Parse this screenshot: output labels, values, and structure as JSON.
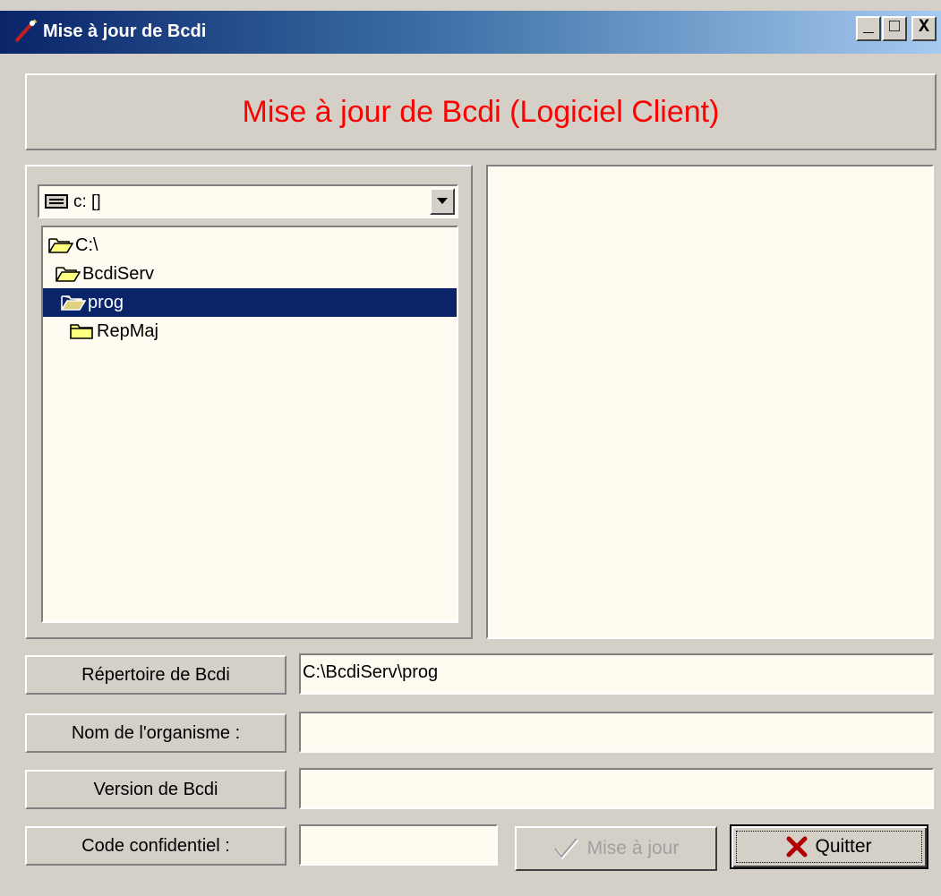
{
  "window": {
    "title": "Mise à jour de Bcdi",
    "controls": {
      "minimize": "_",
      "maximize": "□",
      "close": "X"
    }
  },
  "header": {
    "title": "Mise à jour de Bcdi (Logiciel Client)",
    "color": "#ff0000"
  },
  "drive_combo": {
    "value": "c: []"
  },
  "folder_tree": {
    "items": [
      {
        "label": "C:\\",
        "icon": "open-folder-icon",
        "selected": false
      },
      {
        "label": "BcdiServ",
        "icon": "open-folder-icon",
        "selected": false
      },
      {
        "label": "prog",
        "icon": "open-folder-icon",
        "selected": true
      },
      {
        "label": "RepMaj",
        "icon": "closed-folder-icon",
        "selected": false
      }
    ]
  },
  "fields": {
    "repertoire": {
      "label": "Répertoire de Bcdi",
      "value": "C:\\BcdiServ\\prog"
    },
    "organisme": {
      "label": "Nom de l'organisme :",
      "value": ""
    },
    "version": {
      "label": "Version de Bcdi",
      "value": ""
    },
    "code": {
      "label": "Code confidentiel :",
      "value": ""
    }
  },
  "buttons": {
    "update": {
      "label": "Mise à jour",
      "enabled": false
    },
    "quit": {
      "label": "Quitter",
      "enabled": true
    }
  }
}
